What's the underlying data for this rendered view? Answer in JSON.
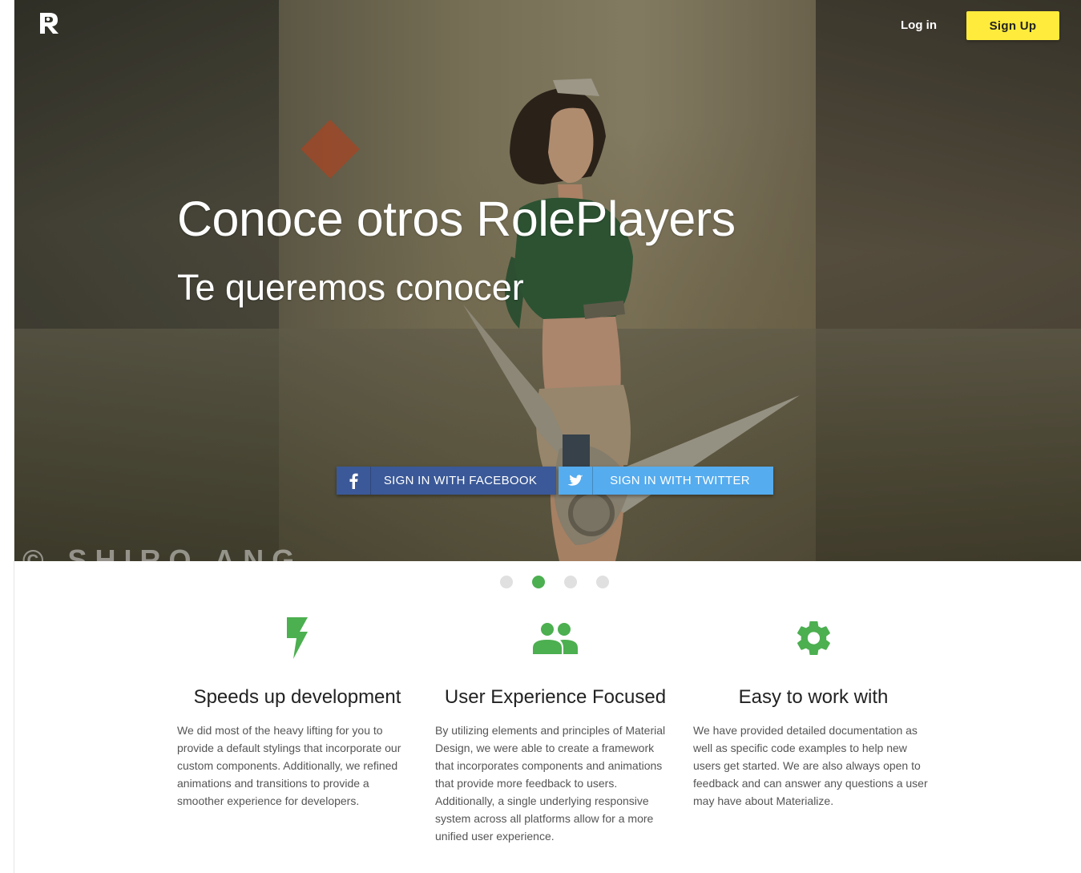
{
  "nav": {
    "logo_letter": "R",
    "login_label": "Log in",
    "signup_label": "Sign Up"
  },
  "hero": {
    "title": "Conoce otros RolePlayers",
    "subtitle": "Te queremos conocer",
    "watermark": "© SHIRO ANG",
    "facebook_label": "SIGN IN WITH FACEBOOK",
    "twitter_label": "SIGN IN WITH TWITTER"
  },
  "carousel": {
    "count": 4,
    "active_index": 1
  },
  "features": [
    {
      "icon": "flash-icon",
      "title": "Speeds up development",
      "text": "We did most of the heavy lifting for you to provide a default stylings that incorporate our custom components. Additionally, we refined animations and transitions to provide a smoother experience for developers."
    },
    {
      "icon": "group-icon",
      "title": "User Experience Focused",
      "text": "By utilizing elements and principles of Material Design, we were able to create a framework that incorporates components and animations that provide more feedback to users. Additionally, a single underlying responsive system across all platforms allow for a more unified user experience."
    },
    {
      "icon": "settings-icon",
      "title": "Easy to work with",
      "text": "We have provided detailed documentation as well as specific code examples to help new users get started. We are also always open to feedback and can answer any questions a user may have about Materialize."
    }
  ],
  "colors": {
    "accent_green": "#4caf50",
    "signup_yellow": "#ffeb3b",
    "facebook_blue": "#3b5998",
    "twitter_blue": "#55acee",
    "dot_inactive": "#e0e0e0"
  }
}
